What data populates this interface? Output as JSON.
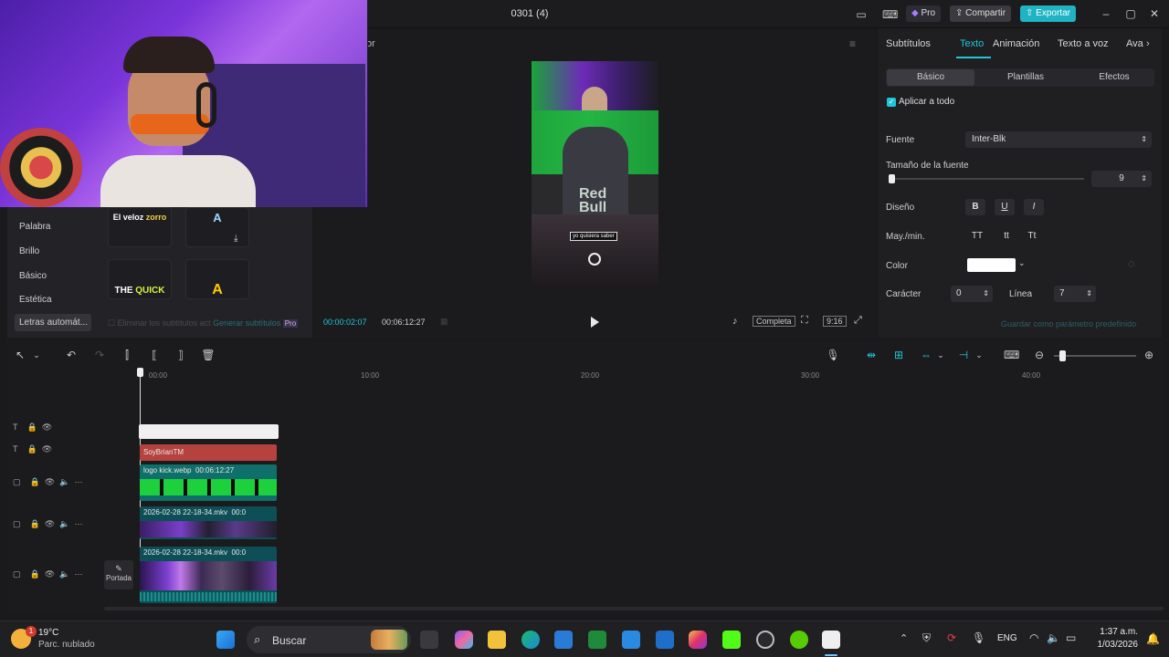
{
  "window": {
    "title": "0301 (4)"
  },
  "titlebar": {
    "pro_label": "Pro",
    "share_label": "Compartir",
    "export_label": "Exportar"
  },
  "library": {
    "items": [
      "Palabra",
      "Brillo",
      "Básico",
      "Estética",
      "Letras automát..."
    ],
    "cards": [
      {
        "text_a": "El veloz ",
        "text_b": "zorro"
      },
      {
        "text": "A"
      },
      {
        "text_a": "THE ",
        "text_b": "QUICK"
      },
      {
        "text": "A"
      }
    ],
    "footer_text": "Eliminar los subtítulos act",
    "footer_link": "Generar subtítulos",
    "footer_badge": "Pro"
  },
  "player": {
    "title": "tor",
    "video_caption": "yo quisiera saber",
    "current_time": "00:00:02:07",
    "total_time": "00:06:12:27",
    "complete_label": "Completa",
    "ratio_label": "9:16"
  },
  "inspector": {
    "tabs": [
      "Subtítulos",
      "Texto",
      "Animación",
      "Texto a voz",
      "Ava"
    ],
    "active_tab": "Texto",
    "subtabs": [
      "Básico",
      "Plantillas",
      "Efectos"
    ],
    "apply_all_label": "Aplicar a todo",
    "font_label": "Fuente",
    "font_value": "Inter-Blk",
    "font_size_label": "Tamaño de la fuente",
    "font_size_value": "9",
    "design_label": "Diseño",
    "design_buttons": [
      "B",
      "U",
      "I"
    ],
    "case_label": "May./min.",
    "case_buttons": [
      "TT",
      "tt",
      "Tt"
    ],
    "color_label": "Color",
    "color_value": "#ffffff",
    "char_label": "Carácter",
    "char_value": "0",
    "line_label": "Línea",
    "line_value": "7",
    "save_preset_label": "Guardar como parámetro predefinido"
  },
  "timeline": {
    "ruler": [
      "00:00",
      "10:00",
      "20:00",
      "30:00",
      "40:00"
    ],
    "clips": {
      "name_clip": "SoyBrianTM",
      "logo_clip": "logo kick.webp",
      "logo_duration": "00:06:12:27",
      "video1": "2026-02-28 22-18-34.mkv",
      "video1_tail": "00:0",
      "video2": "2026-02-28 22-18-34.mkv",
      "video2_tail": "00:0"
    },
    "cover_label": "Portada"
  },
  "taskbar": {
    "weather_temp": "19°C",
    "weather_desc": "Parc. nublado",
    "weather_badge": "1",
    "search_placeholder": "Buscar",
    "lang": "ENG",
    "time": "1:37 a.m.",
    "date": "1/03/2026"
  },
  "colors": {
    "accent": "#1fc6d8",
    "export": "#1fb4c4",
    "name_clip": "#b5423f",
    "logo_clip": "#0f6f6a",
    "video_clip": "#0d4e57"
  }
}
